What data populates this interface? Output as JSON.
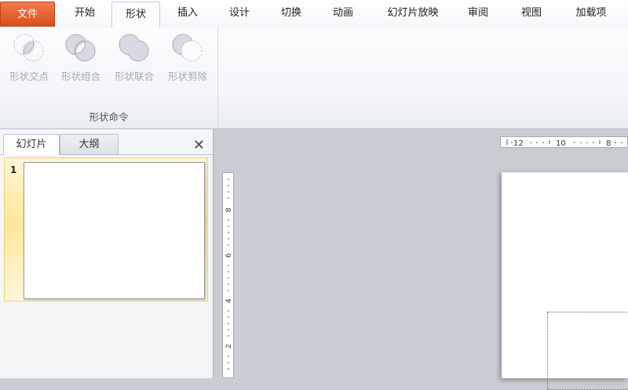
{
  "ribbon_tabs": [
    {
      "label": "文件"
    },
    {
      "label": "开始"
    },
    {
      "label": "形状"
    },
    {
      "label": "插入"
    },
    {
      "label": "设计"
    },
    {
      "label": "切换"
    },
    {
      "label": "动画"
    },
    {
      "label": "幻灯片放映"
    },
    {
      "label": "审阅"
    },
    {
      "label": "视图"
    },
    {
      "label": "加载项"
    }
  ],
  "active_tab": "形状",
  "shape_group": {
    "label": "形状命令",
    "commands": [
      {
        "label": "形状交点",
        "icon": "shape-intersect-icon"
      },
      {
        "label": "形状组合",
        "icon": "shape-combine-icon"
      },
      {
        "label": "形状联合",
        "icon": "shape-union-icon"
      },
      {
        "label": "形状剪除",
        "icon": "shape-subtract-icon"
      }
    ]
  },
  "slides_pane": {
    "tabs": [
      {
        "label": "幻灯片"
      },
      {
        "label": "大纲"
      }
    ],
    "close_glyph": "✕",
    "slides": [
      {
        "number": "1"
      }
    ]
  },
  "rulers": {
    "horizontal_labels": [
      "12",
      "10",
      "8"
    ],
    "vertical_labels": [
      "8",
      "6",
      "4",
      "2"
    ]
  },
  "colors": {
    "file_tab": "#e0612c",
    "selection": "#ffe79a",
    "workspace": "#c9ccd3"
  }
}
